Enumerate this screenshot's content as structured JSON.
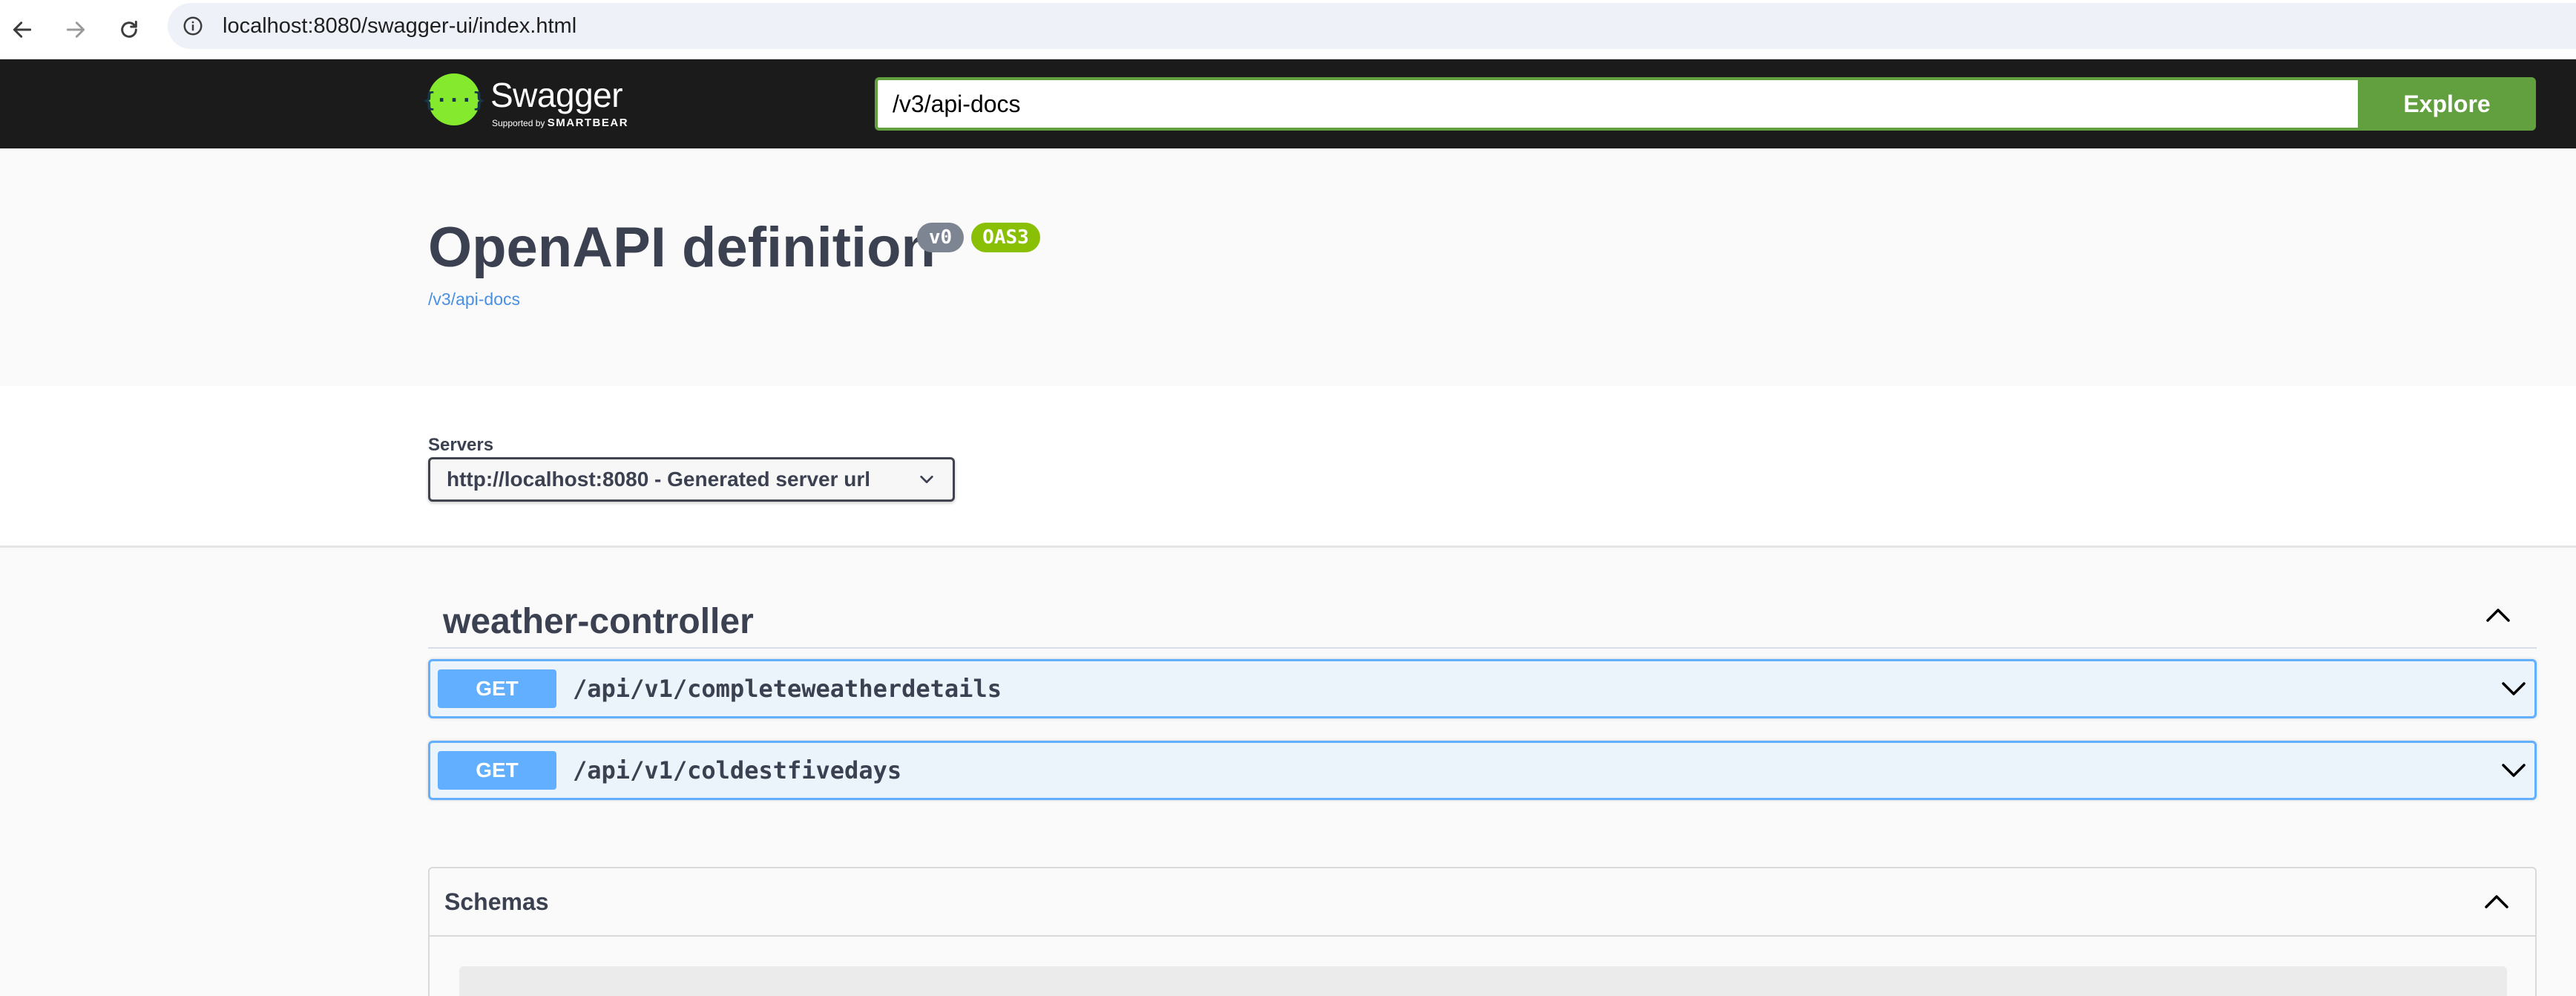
{
  "browser": {
    "url": "localhost:8080/swagger-ui/index.html"
  },
  "topbar": {
    "logo_title": "Swagger",
    "logo_sub_prefix": "Supported by",
    "logo_sub_brand": "SMARTBEAR",
    "logo_glyph": "{···}",
    "spec_url": "/v3/api-docs",
    "explore_label": "Explore"
  },
  "info": {
    "title": "OpenAPI definition",
    "version_badge": "v0",
    "oas_badge": "OAS3",
    "spec_link": "/v3/api-docs"
  },
  "servers": {
    "label": "Servers",
    "selected": "http://localhost:8080 - Generated server url"
  },
  "tag": {
    "name": "weather-controller",
    "operations": [
      {
        "method": "GET",
        "path": "/api/v1/completeweatherdetails"
      },
      {
        "method": "GET",
        "path": "/api/v1/coldestfivedays"
      }
    ]
  },
  "schemas": {
    "title": "Schemas"
  },
  "colors": {
    "get_accent": "#61affe",
    "explore_green": "#62a03f",
    "topbar_bg": "#1b1b1b",
    "oas_badge": "#89bf04",
    "version_badge": "#7d8492"
  }
}
